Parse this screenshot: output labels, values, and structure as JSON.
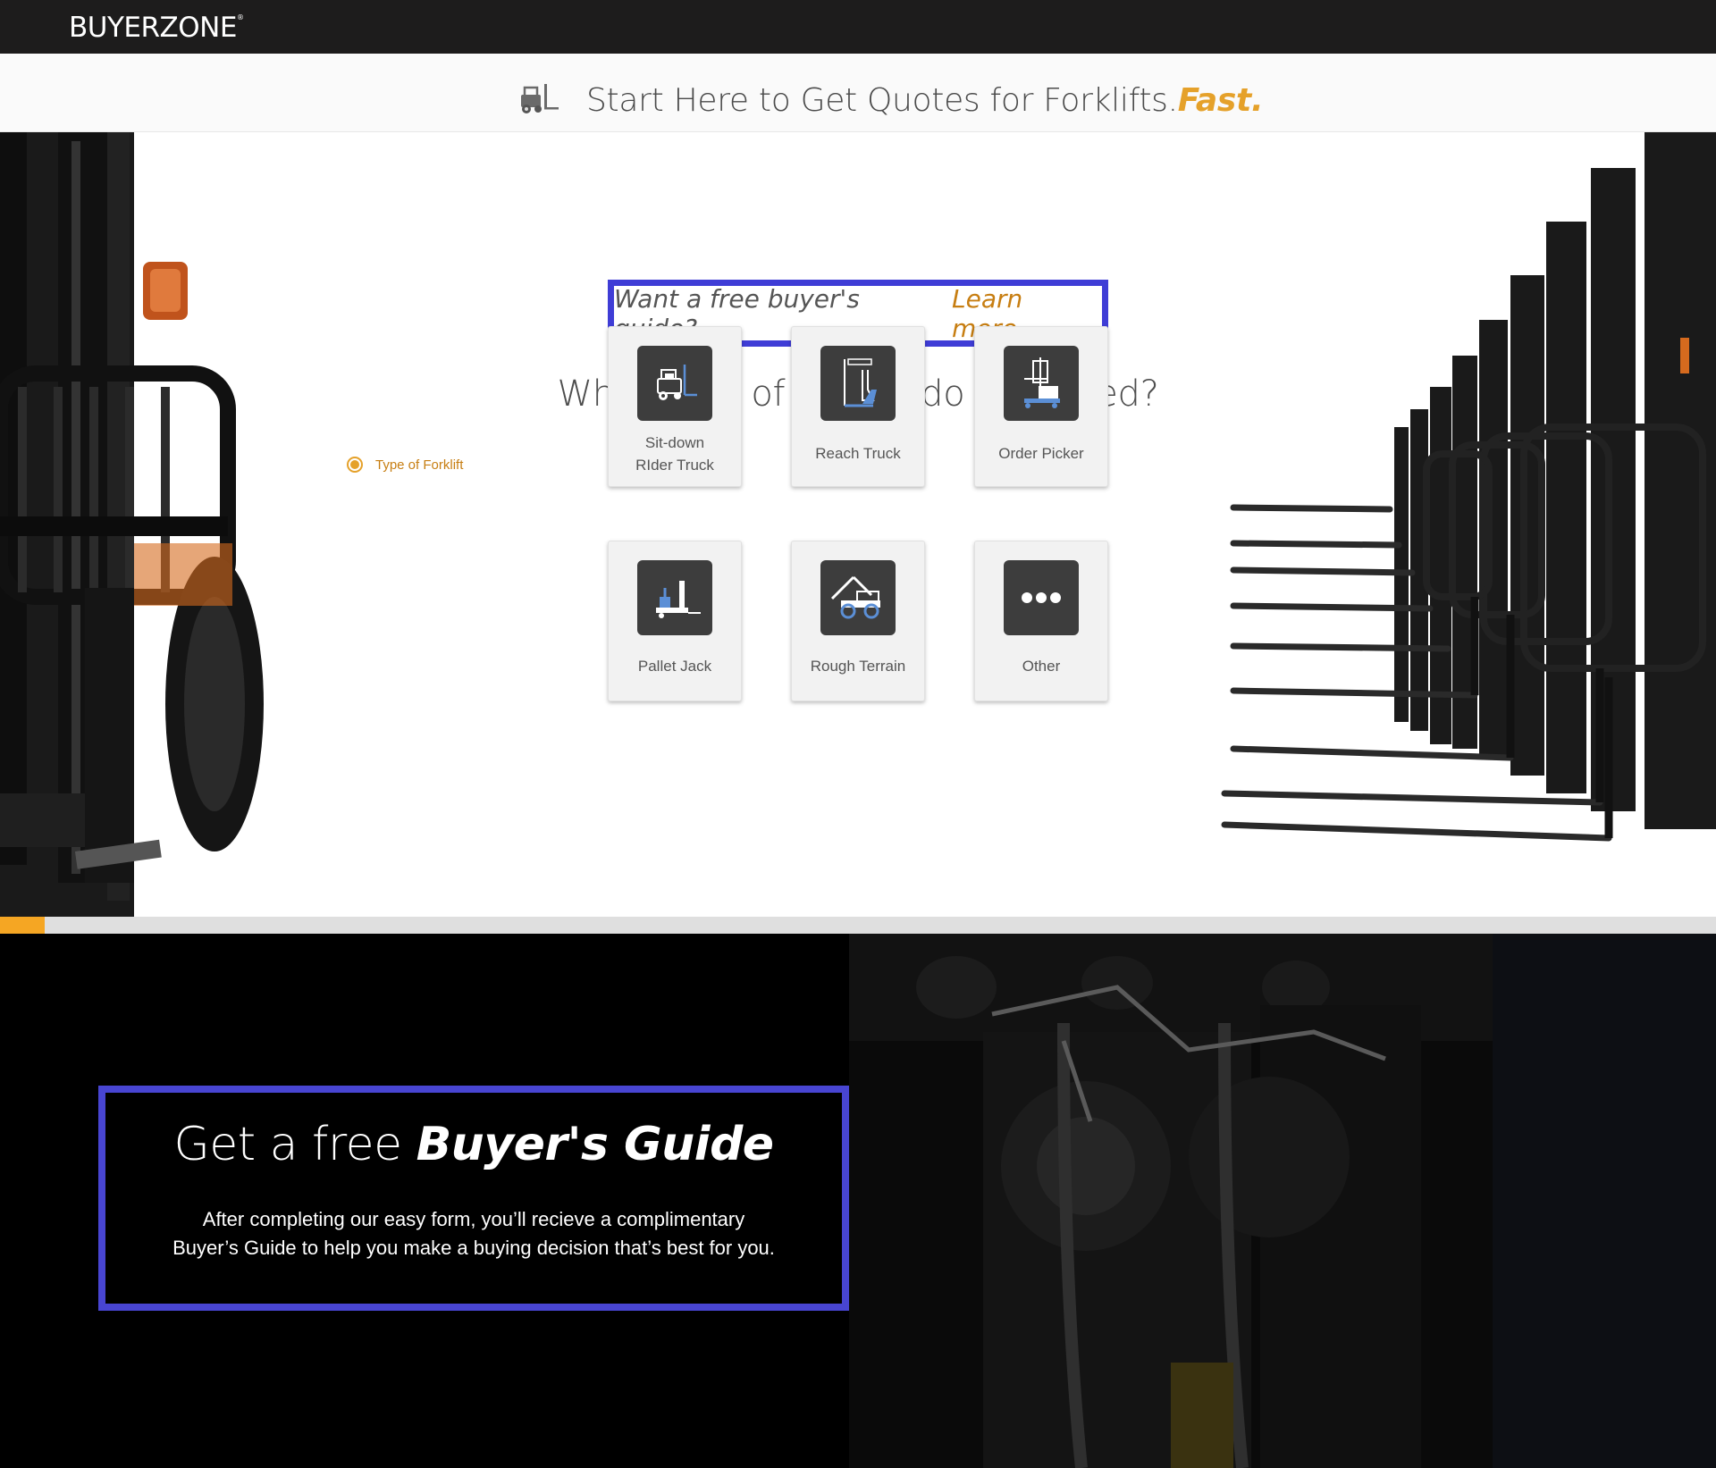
{
  "brand": {
    "logo_text": "BUYERZONE"
  },
  "header": {
    "title": "Start Here to Get Quotes for Forklifts.",
    "title_accent": "Fast.",
    "icon": "forklift-icon"
  },
  "guide_prompt": {
    "question": "Want a free buyer's guide?",
    "link": "Learn more."
  },
  "form": {
    "question": "What type of forklift do you need?",
    "step_label": "Type of Forklift",
    "options": [
      {
        "label": "Sit-down RIder Truck",
        "line1": "Sit-down",
        "line2": "RIder Truck",
        "icon": "sit-down-rider-icon"
      },
      {
        "label": "Reach Truck",
        "icon": "reach-truck-icon"
      },
      {
        "label": "Order Picker",
        "icon": "order-picker-icon"
      },
      {
        "label": "Pallet Jack",
        "icon": "pallet-jack-icon"
      },
      {
        "label": "Rough Terrain",
        "icon": "rough-terrain-icon"
      },
      {
        "label": "Other",
        "icon": "more-dots-icon"
      }
    ],
    "progress_fraction": 0.026
  },
  "buyers_guide": {
    "title_plain": "Get a free",
    "title_bold": "Buyer's Guide",
    "body_line1": "After completing our easy form, you’ll recieve a complimentary",
    "body_line2": "Buyer’s Guide to help you make a buying decision that’s best for you."
  },
  "colors": {
    "accent_orange": "#e5a12a",
    "highlight_border": "#3f3dd6",
    "topbar": "#1d1c1c",
    "icon_blue": "#5b8fd6"
  }
}
